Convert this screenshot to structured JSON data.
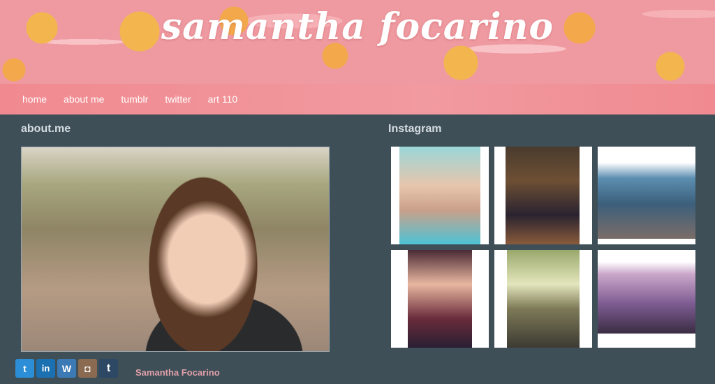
{
  "header": {
    "title": "samantha focarino"
  },
  "nav": {
    "items": [
      "home",
      "about me",
      "tumblr",
      "twitter",
      "art 110"
    ]
  },
  "about": {
    "title": "about.me"
  },
  "instagram": {
    "title": "Instagram"
  },
  "social": {
    "twitter_icon": "t",
    "linkedin_icon": "in",
    "wordpress_icon": "W",
    "instagram_icon": "◘",
    "tumblr_icon": "t"
  },
  "footer": {
    "name": "Samantha Focarino"
  },
  "colors": {
    "background": "#3e4f58",
    "nav": "#f08a90",
    "header": "#ee9aa0",
    "footer_name": "#e2a0a8"
  }
}
